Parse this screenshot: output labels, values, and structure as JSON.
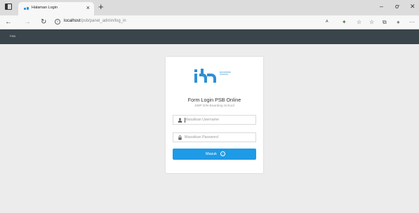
{
  "browser": {
    "tab": {
      "title": "Halaman Login",
      "close_glyph": "×"
    },
    "new_tab_glyph": "+",
    "window_controls": {
      "minimize": "–",
      "maximize": "ơ",
      "close": "✕"
    },
    "address": {
      "host": "localhost",
      "path": "/psb/panel_admin/log_in"
    },
    "nav": {
      "back": "←",
      "forward": "→",
      "refresh": "↻"
    },
    "toolbar_icons": [
      "read-aloud-icon",
      "extension-icon",
      "favorite-icon",
      "favorites-list-icon",
      "collections-icon",
      "profile-icon",
      "more-icon"
    ],
    "toolbar_glyphs": [
      "ᴬ",
      "✦",
      "☆",
      "☆",
      "⧉",
      "●",
      "···"
    ]
  },
  "app": {
    "brand": "PSB"
  },
  "login": {
    "logo_text_line1": "BOARDING",
    "logo_text_line2": "SCHOOL",
    "title": "Form Login PSB Online",
    "subtitle": "SMP IDN Boarding School",
    "username_placeholder": "Masukkan Username",
    "password_placeholder": "Masukkan Password",
    "submit_label": "Masuk",
    "submit_icon_glyph": "›"
  },
  "colors": {
    "navbar": "#39444b",
    "accent": "#1e9ae6",
    "logo": "#2f8fd6",
    "page_background": "#ececec"
  }
}
